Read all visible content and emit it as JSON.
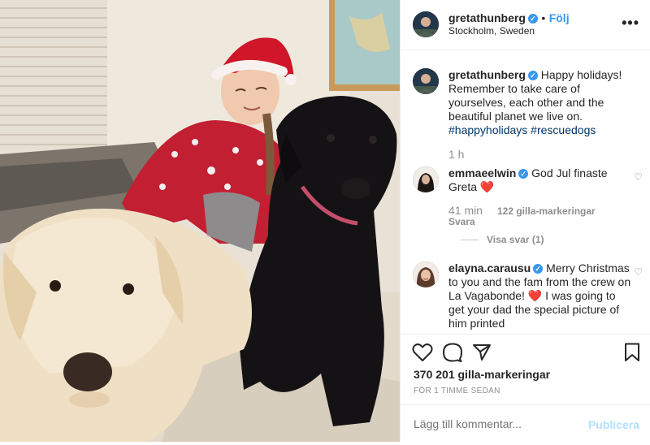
{
  "header": {
    "username": "gretathunberg",
    "verified_mark": "✓",
    "follow_label": "Följ",
    "location": "Stockholm, Sweden",
    "more_icon": "more-horizontal-icon"
  },
  "caption": {
    "username": "gretathunberg",
    "text": "Happy holidays! Remember to take care of yourselves, each other and the beautiful planet we live on.",
    "hashtags": "#happyholidays #rescuedogs",
    "time": "1 h"
  },
  "comments": [
    {
      "username": "emmaeelwin",
      "text": "God Jul finaste Greta",
      "emoji": "❤️",
      "time": "41 min",
      "likes": "122 gilla-markeringar",
      "reply_label": "Svara",
      "view_replies": "Visa svar (1)"
    },
    {
      "username": "elayna.carausu",
      "text_1": "Merry Christmas to you and the fam from the crew on La Vagabonde!",
      "emoji": "❤️",
      "text_2": "I was going to get your dad the special picture of him printed"
    }
  ],
  "actions": {
    "likes": "370 201 gilla-markeringar",
    "time_ago": "FÖR 1 TIMME SEDAN",
    "icons": [
      "heart-icon",
      "comment-icon",
      "share-icon",
      "bookmark-icon"
    ]
  },
  "add_comment": {
    "placeholder": "Lägg till kommentar...",
    "publish_label": "Publicera"
  },
  "colors": {
    "accent": "#3897f0",
    "hashtag": "#00376b",
    "muted": "#8e8e8e",
    "heart": "#ed4956"
  }
}
